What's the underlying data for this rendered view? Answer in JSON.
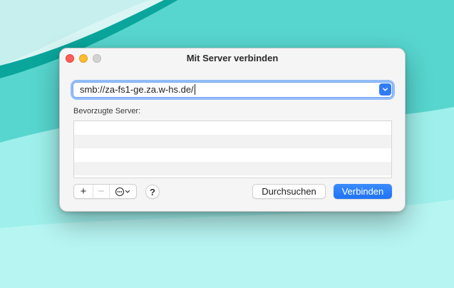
{
  "window": {
    "title": "Mit Server verbinden"
  },
  "address": {
    "value": "smb://za-fs1-ge.za.w-hs.de/",
    "dropdown_icon": "chevron-up-down-icon"
  },
  "favorites": {
    "label": "Bevorzugte Server:",
    "rows": [
      "",
      "",
      "",
      ""
    ]
  },
  "toolbar": {
    "add_label": "+",
    "remove_label": "−",
    "more_icon": "ellipsis-circle-icon",
    "help_label": "?",
    "browse_label": "Durchsuchen",
    "connect_label": "Verbinden"
  },
  "colors": {
    "accent": "#1f73f2",
    "close": "#ff5f57",
    "minimize": "#febc2e",
    "zoom_inactive": "#d2d2d2"
  }
}
